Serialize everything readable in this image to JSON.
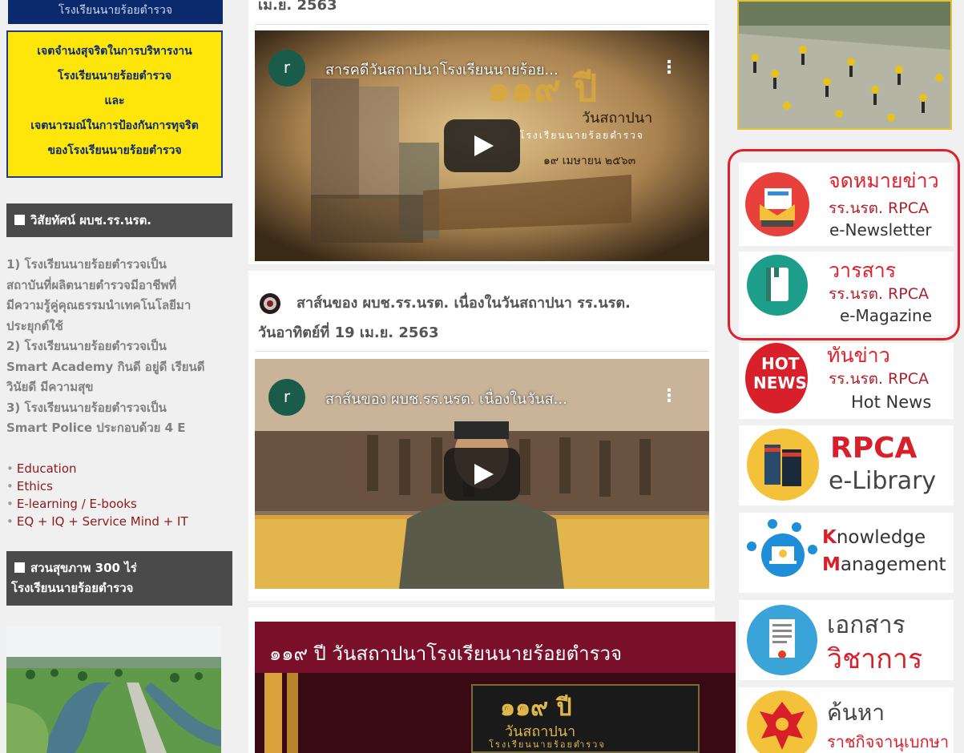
{
  "left": {
    "top_banner": "โรงเรียนนายร้อยตำรวจ",
    "integrity_box": [
      "เจตจำนงสุจริตในการบริหารงาน",
      "โรงเรียนนายร้อยตำรวจ",
      "และ",
      "เจตนารมณ์ในการป้องกันการทุจริต",
      "ของโรงเรียนนายร้อยตำรวจ"
    ],
    "vision_heading": "วิสัยทัศน์ ผบช.รร.นรต.",
    "vision_lines": [
      "1) โรงเรียนนายร้อยตำรวจเป็น",
      "สถาบันที่ผลิตนายตำรวจมีอาชีพที่",
      "มีความรู้คู่คุณธรรมนำเทคโนโลยีมา",
      "ประยุกต์ใช้",
      "2) โรงเรียนนายร้อยตำรวจเป็น",
      "Smart Academy กินดี อยู่ดี เรียนดี",
      "วินัยดี มีความสุข",
      "3) โรงเรียนนายร้อยตำรวจเป็น",
      "Smart Police ประกอบด้วย 4 E"
    ],
    "bullets": [
      "Education",
      "Ethics",
      "E-learning / E-books",
      "EQ + IQ + Service Mind + IT"
    ],
    "park_heading_line1": "สวนสุขภาพ 300 ไร่",
    "park_heading_line2": "โรงเรียนนายร้อยตำรวจ"
  },
  "center": {
    "top_date_fragment": "เม.ย. 2563",
    "video1": {
      "channel_initial": "r",
      "title": "สารคดีวันสถาปนาโรงเรียนนายร้อย...",
      "overlay_line1": "๑๑๙ ปี",
      "overlay_line2": "วันสถาปนา",
      "overlay_line3": "โรงเรียนนายร้อยตำรวจ",
      "overlay_date": "๑๙ เมษายน ๒๕๖๓"
    },
    "post_title_line1": "สาส์นของ ผบช.รร.นรต. เนื่องในวันสถาปนา รร.นรต.",
    "post_title_line2": "วันอาทิตย์ที่ 19 เม.ย. 2563",
    "video2": {
      "channel_initial": "r",
      "title": "สาส์นของ ผบช.รร.นรต. เนื่องในวันส..."
    },
    "banner_title": "๑๑๙ ปี วันสถาปนาโรงเรียนนายร้อยตำรวจ",
    "banner_sub1": "๑๑๙ ปี",
    "banner_sub2": "วันสถาปนา",
    "banner_sub3": "โรงเรียนนายร้อยตำรวจ"
  },
  "right": {
    "newsletter": {
      "line1": "จดหมายข่าว",
      "line2": "รร.นรต. RPCA",
      "line3": "e-Newsletter"
    },
    "magazine": {
      "line1": "วารสาร",
      "line2": "รร.นรต. RPCA",
      "line3": "e-Magazine"
    },
    "hotnews": {
      "badge1": "HOT",
      "badge2": "NEWS!",
      "line1": "ทันข่าว",
      "line2": "รร.นรต. RPCA",
      "line3": "Hot News"
    },
    "library": {
      "line1": "RPCA",
      "line2": "e-Library"
    },
    "km": {
      "k": "K",
      "line1": "nowledge",
      "m": "M",
      "line2": "anagement"
    },
    "academic": {
      "line1": "เอกสาร",
      "line2": "วิชาการ"
    },
    "gazette": {
      "line1": "ค้นหา",
      "line2": "ราชกิจจานุเบกษา"
    }
  },
  "colors": {
    "accent_red": "#e0202b",
    "navy": "#0b2a6e",
    "yellow": "#ffe60a",
    "maroon": "#8b1a1a"
  }
}
